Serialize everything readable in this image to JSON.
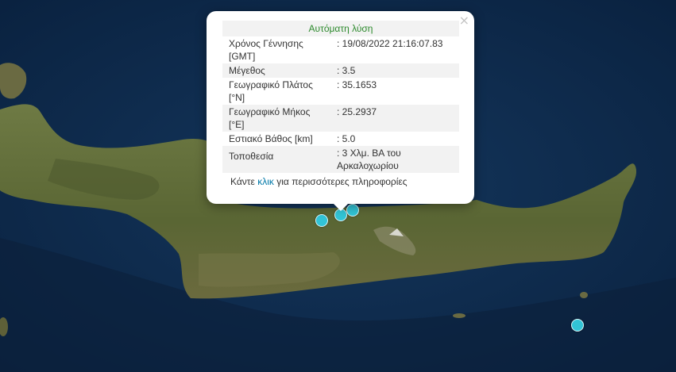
{
  "popup": {
    "title": "Αυτόματη λύση",
    "close_symbol": "×",
    "rows": [
      {
        "label": "Χρόνος Γέννησης [GMT]",
        "value": ": 19/08/2022 21:16:07.83"
      },
      {
        "label": "Μέγεθος",
        "value": ": 3.5"
      },
      {
        "label": "Γεωγραφικό Πλάτος [°N]",
        "value": ": 35.1653"
      },
      {
        "label": "Γεωγραφικό Μήκος [°E]",
        "value": ": 25.2937"
      },
      {
        "label": "Εστιακό Βάθος [km]",
        "value": ": 5.0"
      },
      {
        "label": "Τοποθεσία",
        "value": ": 3 Χλμ. ΒΑ του Αρκαλοχωρίου"
      }
    ],
    "more_prefix": "Κάντε",
    "more_link": "κλικ",
    "more_suffix": "για περισσότερες πληροφορίες"
  },
  "colors": {
    "sea": "#0d2a4a",
    "land": "#5c6a38",
    "marker": "#32c4d6",
    "title_text": "#2d8a2d",
    "link": "#0078a8"
  }
}
